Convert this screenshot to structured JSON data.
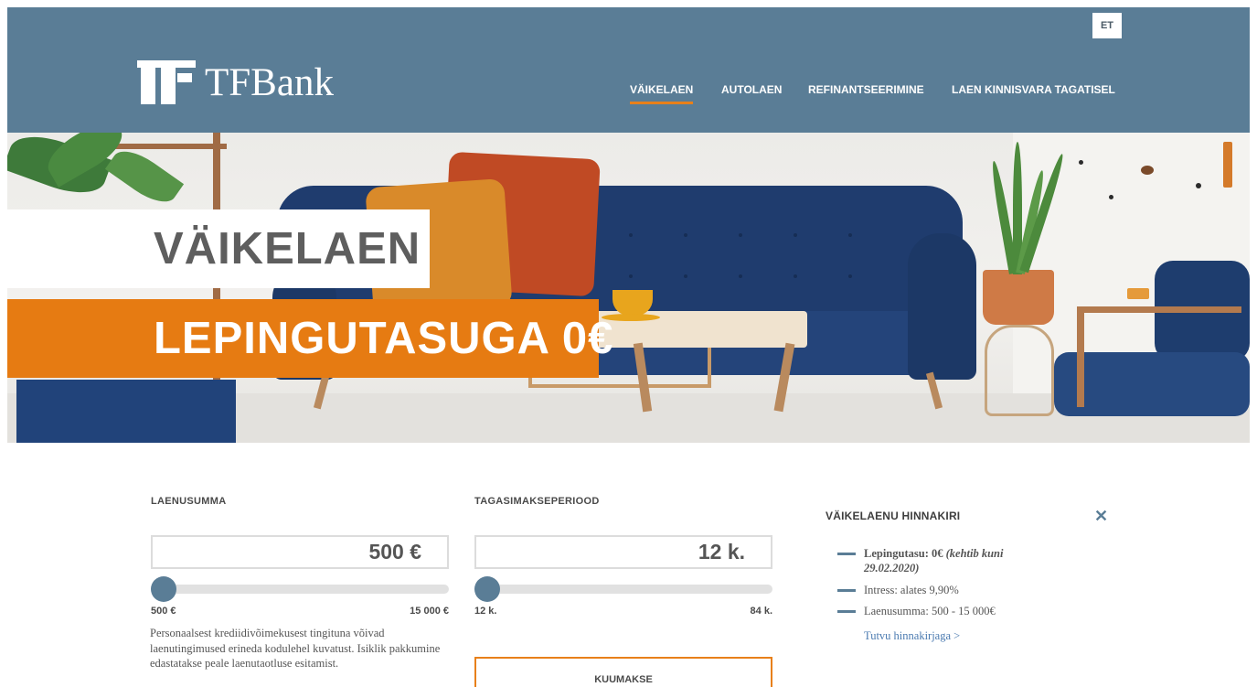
{
  "header": {
    "language": "ET",
    "logo_text": "TFBank",
    "nav": [
      {
        "label": "VÄIKELAEN",
        "active": true
      },
      {
        "label": "AUTOLAEN",
        "active": false
      },
      {
        "label": "REFINANTSEERIMINE",
        "active": false
      },
      {
        "label": "LAEN KINNISVARA TAGATISEL",
        "active": false
      }
    ]
  },
  "hero": {
    "headline": "VÄIKELAEN",
    "subheadline": "LEPINGUTASUGA 0€"
  },
  "calculator": {
    "amount": {
      "label": "LAENUSUMMA",
      "value": "500 €",
      "min_label": "500 €",
      "max_label": "15 000 €",
      "level": 0
    },
    "period": {
      "label": "TAGASIMAKSEPERIOOD",
      "value": "12 k.",
      "min_label": "12 k.",
      "max_label": "84 k.",
      "level": 0
    },
    "note": "Personaalsest krediidivõimekusest tingituna võivad laenutingimused erineda kodulehel kuvatust. Isiklik pakkumine edastatakse peale laenutaotluse esitamist.",
    "monthly_button": "KUUMAKSE"
  },
  "price_list": {
    "title": "VÄIKELAENU HINNAKIRI",
    "close_icon": "close-icon",
    "items": [
      {
        "label": "Lepingutasu: 0€",
        "extra": "(kehtib kuni 29.02.2020)"
      },
      {
        "label": "Intress: alates 9,90%"
      },
      {
        "label": "Laenusumma: 500 - 15 000€"
      }
    ],
    "link": "Tutvu hinnakirjaga >"
  },
  "colors": {
    "header_bg": "#5a7d96",
    "accent_orange": "#e67b12",
    "slider_knob": "#5a7d96"
  }
}
